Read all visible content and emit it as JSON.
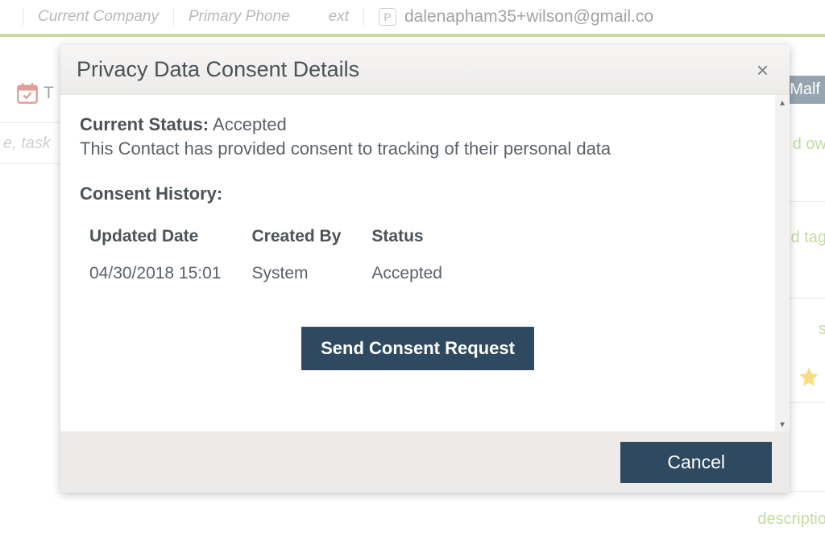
{
  "background": {
    "header": {
      "company_label": "Current Company",
      "phone_label": "Primary Phone",
      "ext_label": "ext",
      "p_badge": "P",
      "email": "dalenapham35+wilson@gmail.co"
    },
    "row2": {
      "cal_letter": "T"
    },
    "malf_badge": "Malf",
    "search_placeholder": "e, task",
    "right_owner_fragment": "d ow",
    "right_tag_fragment": "d tag",
    "right_s_fragment": "s",
    "right_description_fragment": "descriptio"
  },
  "modal": {
    "title": "Privacy Data Consent Details",
    "close_glyph": "×",
    "status_label": "Current Status:",
    "status_value": "Accepted",
    "description": "This Contact has provided consent to tracking of their personal data",
    "history_title": "Consent History:",
    "history": {
      "columns": {
        "updated": "Updated Date",
        "created_by": "Created By",
        "status": "Status"
      },
      "rows": [
        {
          "updated": "04/30/2018 15:01",
          "created_by": "System",
          "status": "Accepted"
        }
      ]
    },
    "send_button": "Send Consent Request",
    "cancel_button": "Cancel",
    "scroll_up": "▴",
    "scroll_down": "▾"
  }
}
